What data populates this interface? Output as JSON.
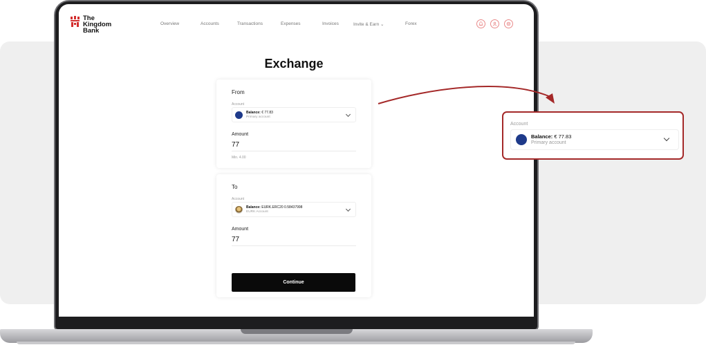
{
  "brand": {
    "name_line1": "The",
    "name_line2": "Kingdom",
    "name_line3": "Bank",
    "color": "#d32f2f"
  },
  "nav": {
    "links": [
      "Overview",
      "Accounts",
      "Transactions",
      "Expenses",
      "Invoices",
      "Invite & Earn",
      "Forex"
    ],
    "icons": [
      "bell-icon",
      "user-icon",
      "settings-icon"
    ]
  },
  "page": {
    "title": "Exchange"
  },
  "from": {
    "heading": "From",
    "account_label": "Account",
    "balance_label": "Balance:",
    "balance_value": "€ 77.83",
    "account_name": "Primary account",
    "amount_label": "Amount",
    "amount_value": "77",
    "min_text": "Min. 4.00"
  },
  "to": {
    "heading": "To",
    "account_label": "Account",
    "balance_label": "Balance:",
    "balance_value": "EURK.ERC20 0.58437998",
    "account_name": "EURK Account",
    "amount_label": "Amount",
    "amount_value": "77"
  },
  "continue_label": "Continue",
  "callout": {
    "account_label": "Account",
    "balance_label": "Balance:",
    "balance_value": "€ 77.83",
    "account_name": "Primary account",
    "border_color": "#a42828"
  }
}
